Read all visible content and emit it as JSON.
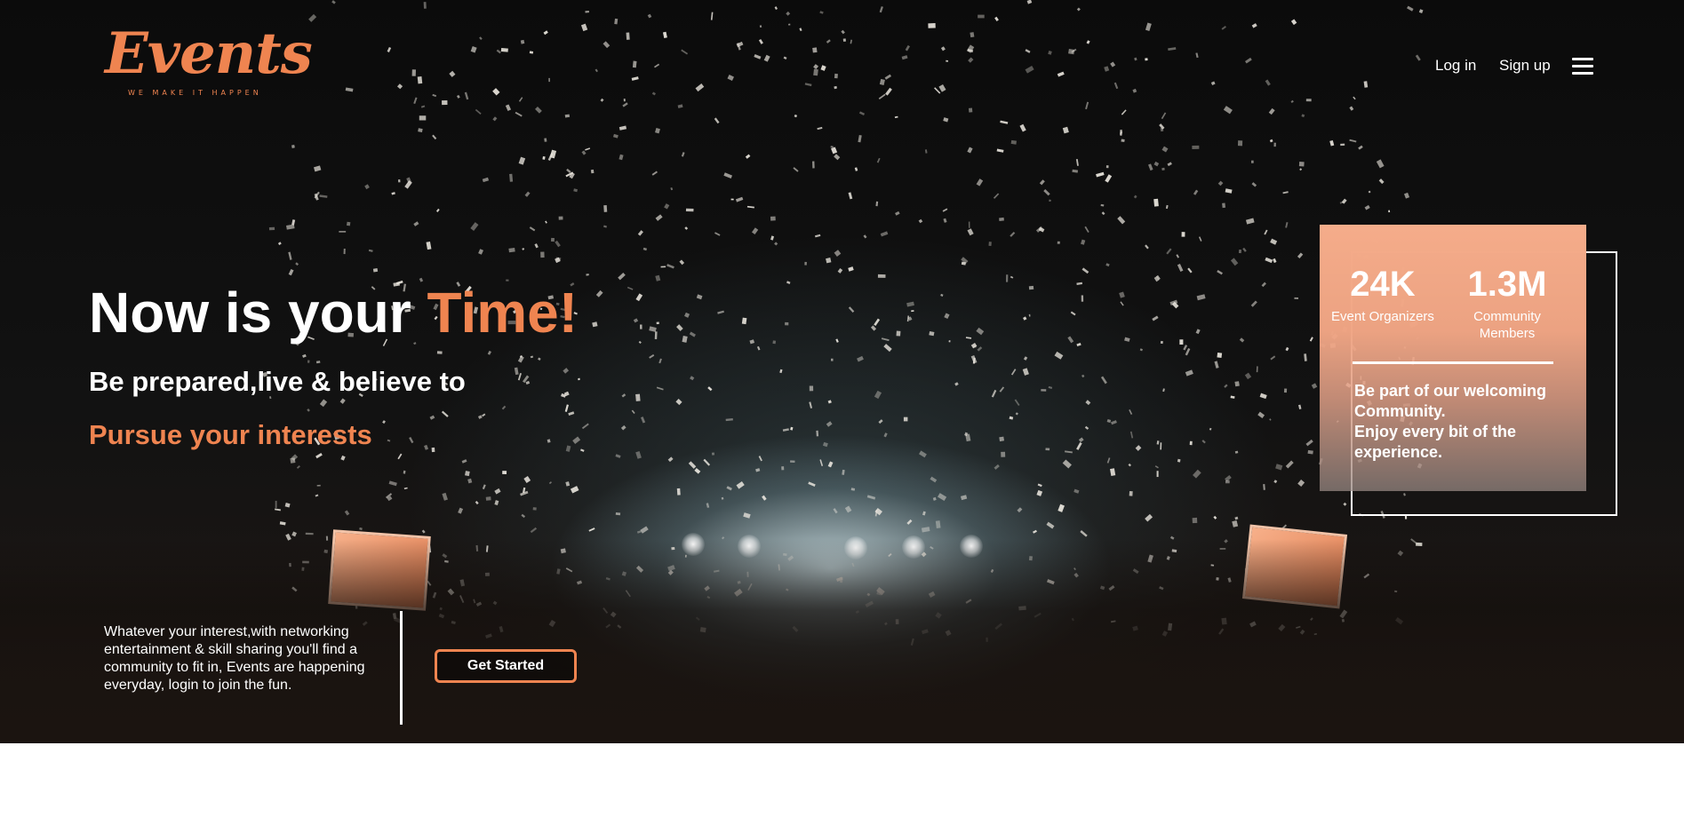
{
  "brand": {
    "name": "Events",
    "tagline": "WE MAKE IT HAPPEN",
    "accent_color": "#ef8450"
  },
  "nav": {
    "login_label": "Log in",
    "signup_label": "Sign up",
    "menu_icon": "hamburger-menu-icon"
  },
  "hero": {
    "headline_prefix": "Now is your ",
    "headline_accent": "Time!",
    "subheadline_line1": "Be prepared,live & believe to",
    "subheadline_line2": "Pursue your interests",
    "description": "Whatever your interest,with networking entertainment & skill sharing you'll find a community to fit in, Events are happening everyday, login to join the fun.",
    "cta_label": "Get Started"
  },
  "stats": {
    "items": [
      {
        "value": "24K",
        "label": "Event Organizers"
      },
      {
        "value": "1.3M",
        "label": "Community Members"
      }
    ],
    "blurb_line1": "Be part of our welcoming Community.",
    "blurb_line2": "Enjoy every bit of the experience."
  }
}
